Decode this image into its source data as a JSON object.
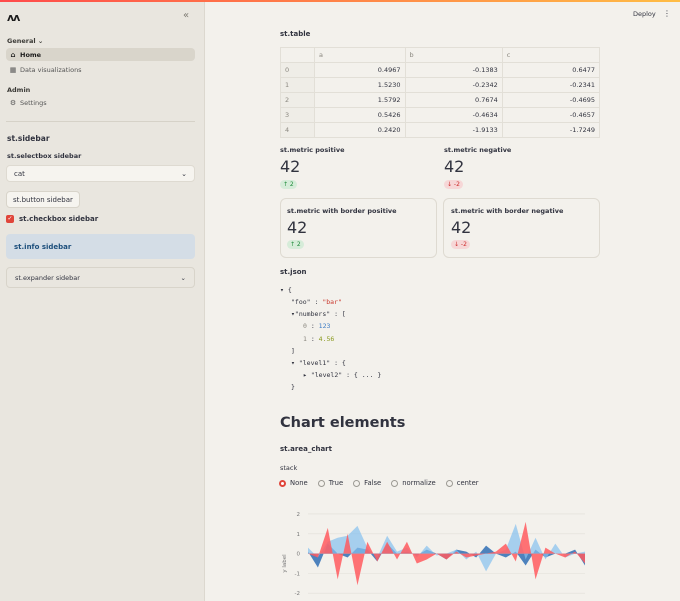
{
  "sidebar": {
    "logo": "ʌʌ",
    "collapse_icon": "«",
    "group_general": "General",
    "group_admin": "Admin",
    "items": [
      {
        "label": "Home",
        "icon": "home-icon"
      },
      {
        "label": "Data visualizations",
        "icon": "chart-icon"
      },
      {
        "label": "Settings",
        "icon": "gear-icon"
      }
    ],
    "title": "st.sidebar",
    "selectbox_label": "st.selectbox sidebar",
    "selectbox_value": "cat",
    "button_label": "st.button sidebar",
    "checkbox_label": "st.checkbox sidebar",
    "info_text": "st.info sidebar",
    "expander_label": "st.expander sidebar"
  },
  "header": {
    "deploy": "Deploy",
    "menu_icon": "⋮"
  },
  "table": {
    "title": "st.table",
    "columns": [
      "",
      "a",
      "b",
      "c"
    ],
    "rows": [
      [
        "0",
        "0.4967",
        "-0.1383",
        "0.6477"
      ],
      [
        "1",
        "1.5230",
        "-0.2342",
        "-0.2341"
      ],
      [
        "2",
        "1.5792",
        "0.7674",
        "-0.4695"
      ],
      [
        "3",
        "0.5426",
        "-0.4634",
        "-0.4657"
      ],
      [
        "4",
        "0.2420",
        "-1.9133",
        "-1.7249"
      ]
    ]
  },
  "metrics": {
    "positive": {
      "label": "st.metric positive",
      "value": "42",
      "delta": "↑ 2"
    },
    "negative": {
      "label": "st.metric negative",
      "value": "42",
      "delta": "↓ -2"
    },
    "border_positive": {
      "label": "st.metric with border positive",
      "value": "42",
      "delta": "↑ 2"
    },
    "border_negative": {
      "label": "st.metric with border negative",
      "value": "42",
      "delta": "↓ -2"
    }
  },
  "json": {
    "title": "st.json",
    "lines": {
      "open": "{",
      "foo_key": "\"foo\"",
      "foo_val": "\"bar\"",
      "numbers_key": "\"numbers\"",
      "idx0": "0",
      "val0": "123",
      "idx1": "1",
      "val1": "4.56",
      "bracket_close": "]",
      "level1_key": "\"level1\"",
      "level2_key": "\"level2\"",
      "level2_val": "{ ... }",
      "brace_close": "}"
    }
  },
  "chart_section": {
    "heading": "Chart elements",
    "area_chart_label": "st.area_chart",
    "stack_label": "stack",
    "stack_options": [
      "None",
      "True",
      "False",
      "normalize",
      "center"
    ],
    "stack_selected": "None"
  },
  "chart_data": {
    "type": "area",
    "ylabel": "y label",
    "yticks": [
      2,
      1,
      0,
      -1,
      -2,
      -3
    ],
    "ylim": [
      -3,
      2.2
    ],
    "series": [
      {
        "color": "#2f6fb5",
        "values": [
          0.1,
          -0.7,
          0.5,
          0.0,
          -0.2,
          0.3,
          0.2,
          -0.4,
          0.5,
          0.0,
          0.1,
          -0.1,
          0.2,
          0.0,
          -0.3,
          0.2,
          0.1,
          -0.2,
          0.4,
          0.0,
          -0.2,
          0.1,
          -0.6,
          0.2,
          -0.2,
          0.0,
          0.0,
          0.2,
          -0.6
        ]
      },
      {
        "color": "#85c0ef",
        "values": [
          0.3,
          -0.2,
          0.6,
          0.8,
          0.9,
          1.4,
          0.3,
          -0.2,
          0.9,
          0.1,
          0.3,
          -0.2,
          0.4,
          -0.1,
          0.0,
          0.2,
          -0.3,
          0.1,
          -0.9,
          0.0,
          0.2,
          1.5,
          -0.3,
          0.8,
          -0.3,
          0.5,
          -0.2,
          0.0,
          0.1
        ]
      },
      {
        "color": "#ff5a5f",
        "values": [
          0.0,
          -0.2,
          1.3,
          -1.3,
          1.0,
          -1.6,
          0.6,
          -0.4,
          0.6,
          -0.3,
          0.6,
          -0.5,
          -0.3,
          0.0,
          -0.3,
          0.1,
          -0.2,
          -0.1,
          0.0,
          0.1,
          0.5,
          -0.4,
          1.6,
          -1.3,
          0.3,
          0.0,
          -0.2,
          0.1,
          -0.5
        ]
      }
    ]
  }
}
